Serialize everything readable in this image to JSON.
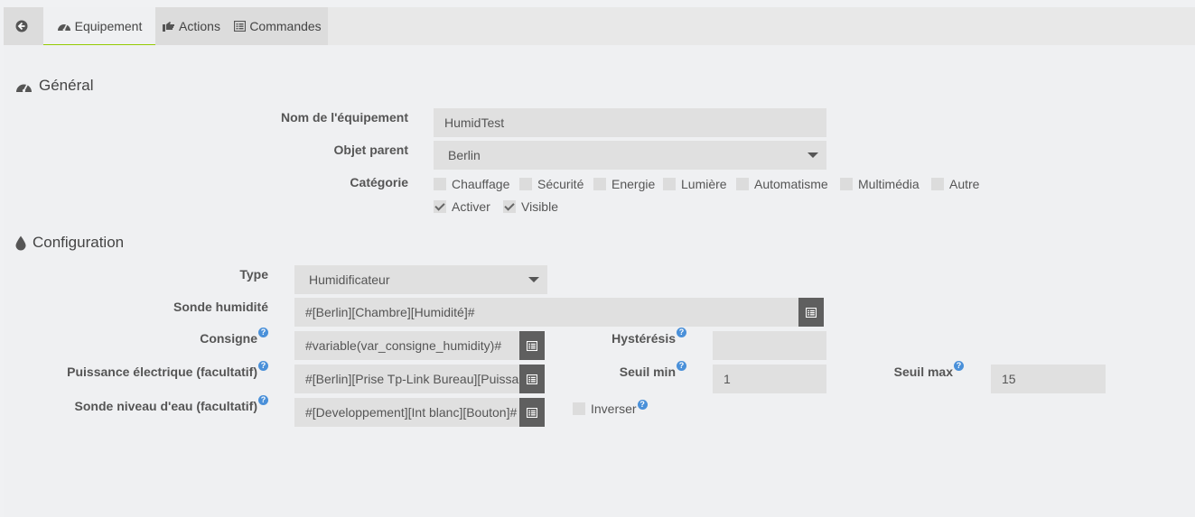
{
  "tabs": {
    "back_icon": "arrow-circle-left-icon",
    "equipement": "Equipement",
    "actions": "Actions",
    "commandes": "Commandes"
  },
  "general": {
    "title": "Général",
    "name_label": "Nom de l'équipement",
    "name_value": "HumidTest",
    "parent_label": "Objet parent",
    "parent_value": "Berlin",
    "category_label": "Catégorie",
    "categories": [
      {
        "label": "Chauffage",
        "checked": false
      },
      {
        "label": "Sécurité",
        "checked": false
      },
      {
        "label": "Energie",
        "checked": false
      },
      {
        "label": "Lumière",
        "checked": false
      },
      {
        "label": "Automatisme",
        "checked": false
      },
      {
        "label": "Multimédia",
        "checked": false
      },
      {
        "label": "Autre",
        "checked": false
      }
    ],
    "activer": {
      "label": "Activer",
      "checked": true
    },
    "visible": {
      "label": "Visible",
      "checked": true
    }
  },
  "config": {
    "title": "Configuration",
    "type_label": "Type",
    "type_value": "Humidificateur",
    "sonde_label": "Sonde humidité",
    "sonde_value": "#[Berlin][Chambre][Humidité]#",
    "consigne_label": "Consigne",
    "consigne_value": "#variable(var_consigne_humidity)#",
    "hysteresis_label": "Hystérésis",
    "hysteresis_value": "",
    "puissance_label": "Puissance électrique (facultatif)",
    "puissance_value": "#[Berlin][Prise Tp-Link Bureau][Puissance]#",
    "seuil_min_label": "Seuil min",
    "seuil_min_value": "1",
    "seuil_max_label": "Seuil max",
    "seuil_max_value": "15",
    "niveau_label": "Sonde niveau d'eau (facultatif)",
    "niveau_value": "#[Developpement][Int blanc][Bouton]#",
    "inverser_label": "Inverser",
    "help_glyph": "?"
  }
}
